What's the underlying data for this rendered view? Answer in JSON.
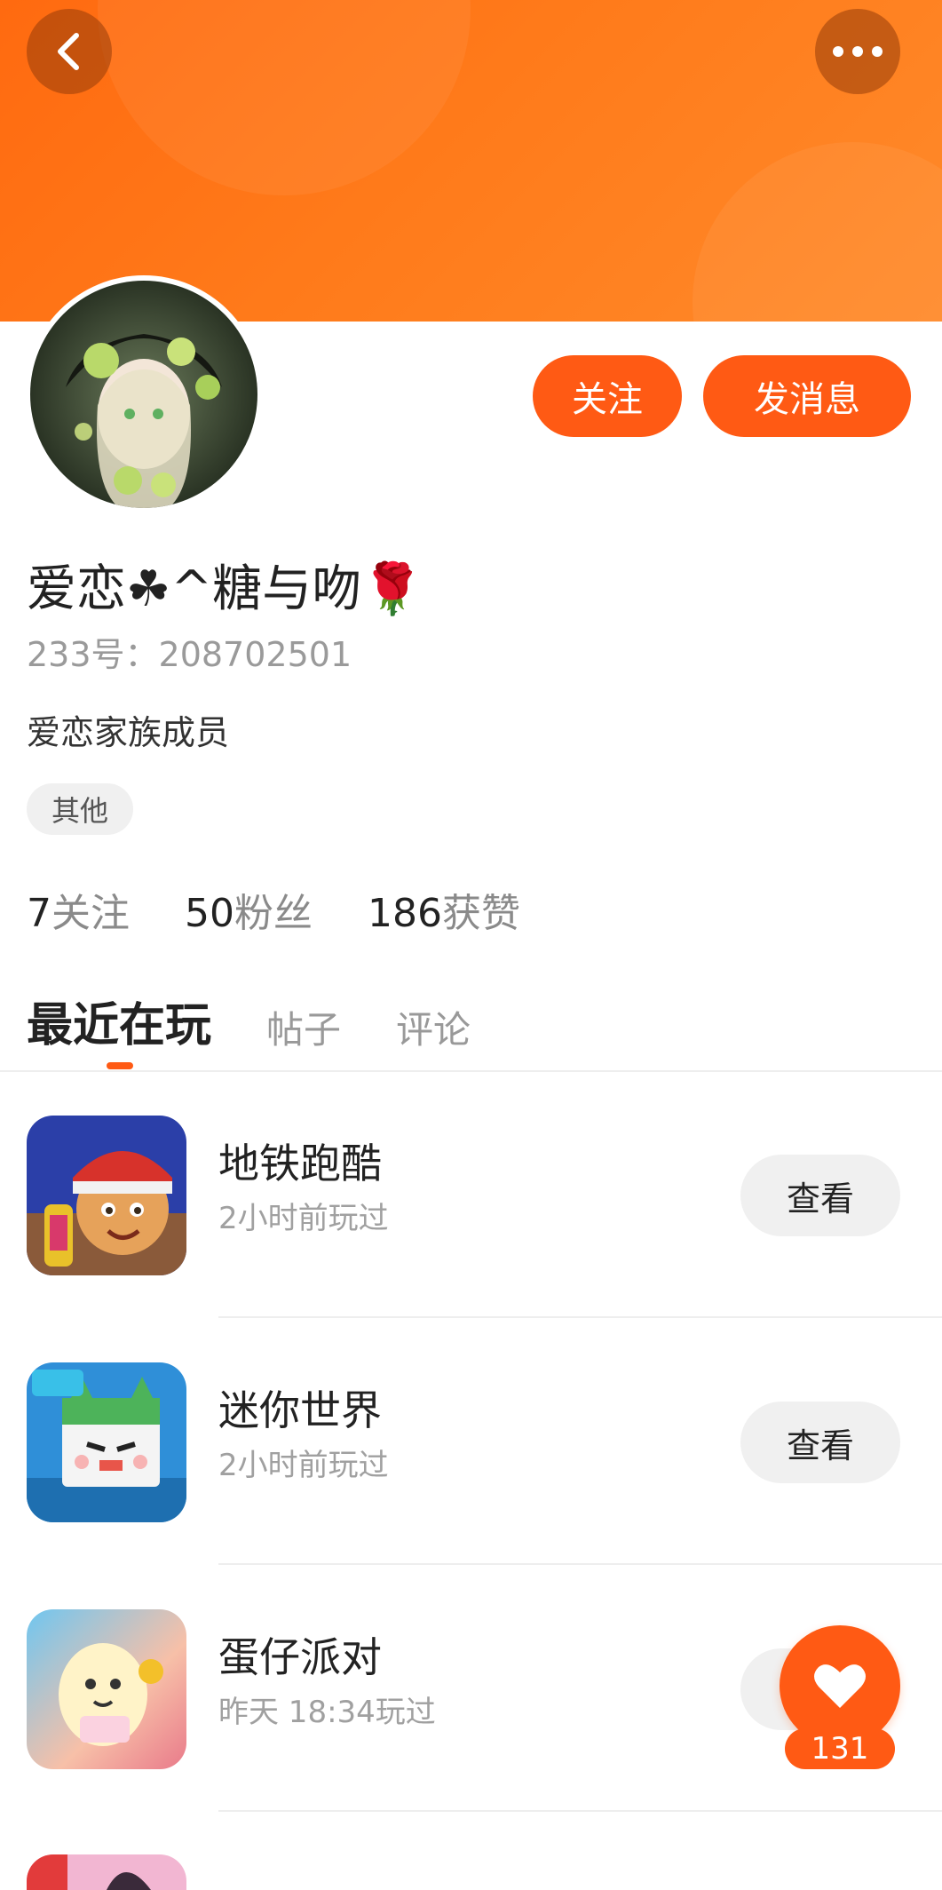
{
  "profile": {
    "nickname": "爱恋☘^糖与吻🌹",
    "uid_label": "233号：",
    "uid": "208702501",
    "bio": "爱恋家族成员",
    "tag": "其他",
    "follow_label": "关注",
    "message_label": "发消息"
  },
  "stats": [
    {
      "num": "7",
      "label": "关注"
    },
    {
      "num": "50",
      "label": "粉丝"
    },
    {
      "num": "186",
      "label": "获赞"
    }
  ],
  "tabs": [
    "最近在玩",
    "帖子",
    "评论"
  ],
  "games": [
    {
      "name": "地铁跑酷",
      "time": "2小时前玩过",
      "action": "查看"
    },
    {
      "name": "迷你世界",
      "time": "2小时前玩过",
      "action": "查看"
    },
    {
      "name": "蛋仔派对",
      "time": "昨天 18:34玩过",
      "action": "查看"
    }
  ],
  "likes": "131",
  "colors": {
    "accent": "#ff5a14",
    "header": "#ff7a1a"
  },
  "icons": [
    "back-icon",
    "more-icon",
    "heart-icon"
  ]
}
